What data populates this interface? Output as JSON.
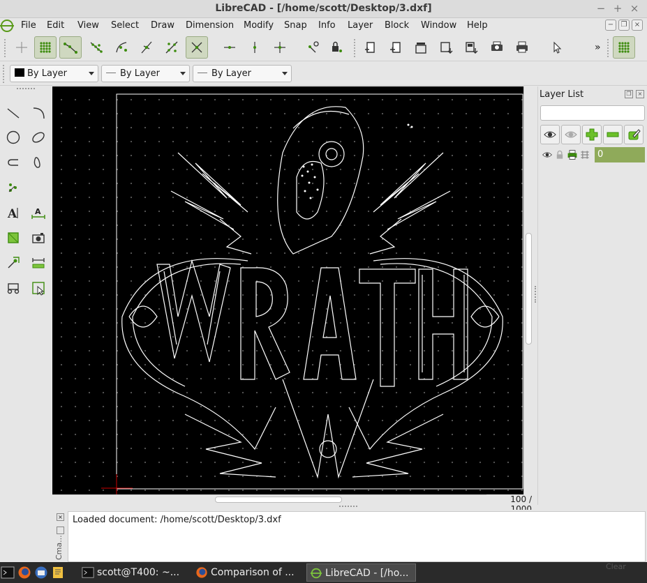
{
  "window": {
    "title": "LibreCAD - [/home/scott/Desktop/3.dxf]",
    "controls": {
      "minimize": "−",
      "maximize": "+",
      "close": "×"
    }
  },
  "menubar": {
    "items": [
      {
        "label": "File"
      },
      {
        "label": "Edit"
      },
      {
        "label": "View"
      },
      {
        "label": "Select"
      },
      {
        "label": "Draw"
      },
      {
        "label": "Dimension"
      },
      {
        "label": "Modify"
      },
      {
        "label": "Snap"
      },
      {
        "label": "Info"
      },
      {
        "label": "Layer"
      },
      {
        "label": "Block"
      },
      {
        "label": "Window"
      },
      {
        "label": "Help"
      }
    ],
    "mdi_controls": [
      "−",
      "❐",
      "×"
    ]
  },
  "toolbar_top": {
    "overflow": "»",
    "icons": [
      "crosshair-icon",
      "grid-snap-icon",
      "snap-endpoint-icon",
      "snap-on-entity-icon",
      "snap-center-icon",
      "snap-middle-icon",
      "snap-distance-icon",
      "snap-intersection-icon",
      "restrict-horizontal-icon",
      "restrict-vertical-icon",
      "restrict-orthogonal-icon",
      "relative-zero-icon",
      "lock-relative-zero-icon",
      "new-document-icon",
      "new-from-template-icon",
      "open-document-icon",
      "save-icon",
      "save-as-icon",
      "print-preview-icon",
      "print-icon",
      "select-pointer-icon",
      "grid-toggle-icon"
    ]
  },
  "toolbar_pen": {
    "color": "By Layer",
    "linetype": "By Layer",
    "linewidth": "By Layer"
  },
  "left_tools": [
    "line-icon",
    "arc-icon",
    "circle-icon",
    "ellipse-icon",
    "polyline-icon",
    "spline-icon",
    "point-icon",
    "text-icon",
    "dimension-icon",
    "hatch-icon",
    "image-icon",
    "modify-icon",
    "measure-icon",
    "block-icon",
    "select-icon"
  ],
  "canvas": {
    "background": "#000000",
    "zoom_label": "100 / 1000",
    "drawing_title": "Wrath",
    "crosshair_color": "#cc0000"
  },
  "layer_list": {
    "title": "Layer List",
    "filter_value": "",
    "layers": [
      {
        "name": "0",
        "visible": true,
        "locked": false,
        "printable": true
      }
    ],
    "highlight_color": "#8faa5a"
  },
  "command": {
    "history": "Loaded document: /home/scott/Desktop/3.dxf",
    "side_label": "Cma..."
  },
  "taskbar": {
    "tasks": [
      {
        "label": "scott@T400: ~..."
      },
      {
        "label": "Comparison of ..."
      },
      {
        "label": "LibreCAD - [/ho..."
      }
    ],
    "tray_label": "Clear"
  }
}
